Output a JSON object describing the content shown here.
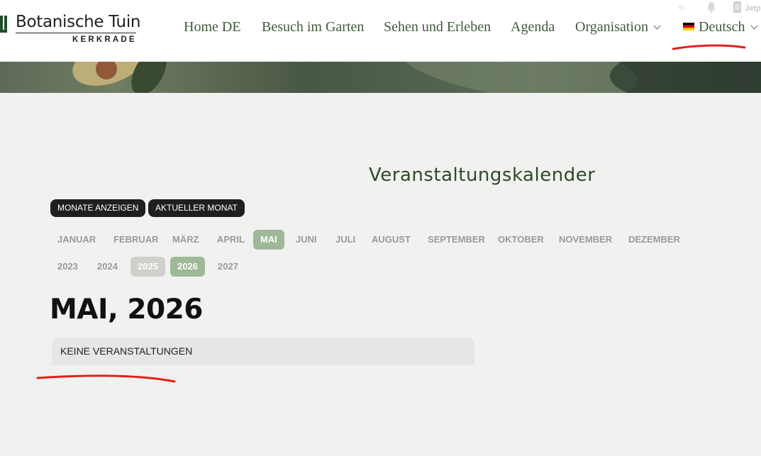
{
  "logo": {
    "title": "Botanische Tuin",
    "subtitle": "KERKRADE"
  },
  "nav": {
    "items": [
      {
        "label": "Home DE"
      },
      {
        "label": "Besuch im Garten"
      },
      {
        "label": "Sehen und Erleben"
      },
      {
        "label": "Agenda"
      },
      {
        "label": "Organisation"
      },
      {
        "label": "Deutsch"
      }
    ]
  },
  "admin_bar": {
    "icons": [
      "sparkle-icon",
      "bell-icon",
      "document-icon"
    ],
    "text": "Jetp"
  },
  "calendar": {
    "title": "Veranstaltungskalender",
    "buttons": {
      "show_months": "MONATE ANZEIGEN",
      "current_month": "AKTUELLER MONAT"
    },
    "months": [
      "JANUAR",
      "FEBRUAR",
      "MÄRZ",
      "APRIL",
      "MAI",
      "JUNI",
      "JULI",
      "AUGUST",
      "SEPTEMBER",
      "OKTOBER",
      "NOVEMBER",
      "DEZEMBER"
    ],
    "selected_month": "MAI",
    "years": [
      "2023",
      "2024",
      "2025",
      "2026",
      "2027"
    ],
    "selected_year": "2026",
    "heading": "MAI, 2026",
    "empty_message": "KEINE VERANSTALTUNGEN"
  },
  "colors": {
    "accent_green": "#9fb897",
    "nav_text": "#3f5c3a",
    "annotation_red": "#e3201b"
  }
}
